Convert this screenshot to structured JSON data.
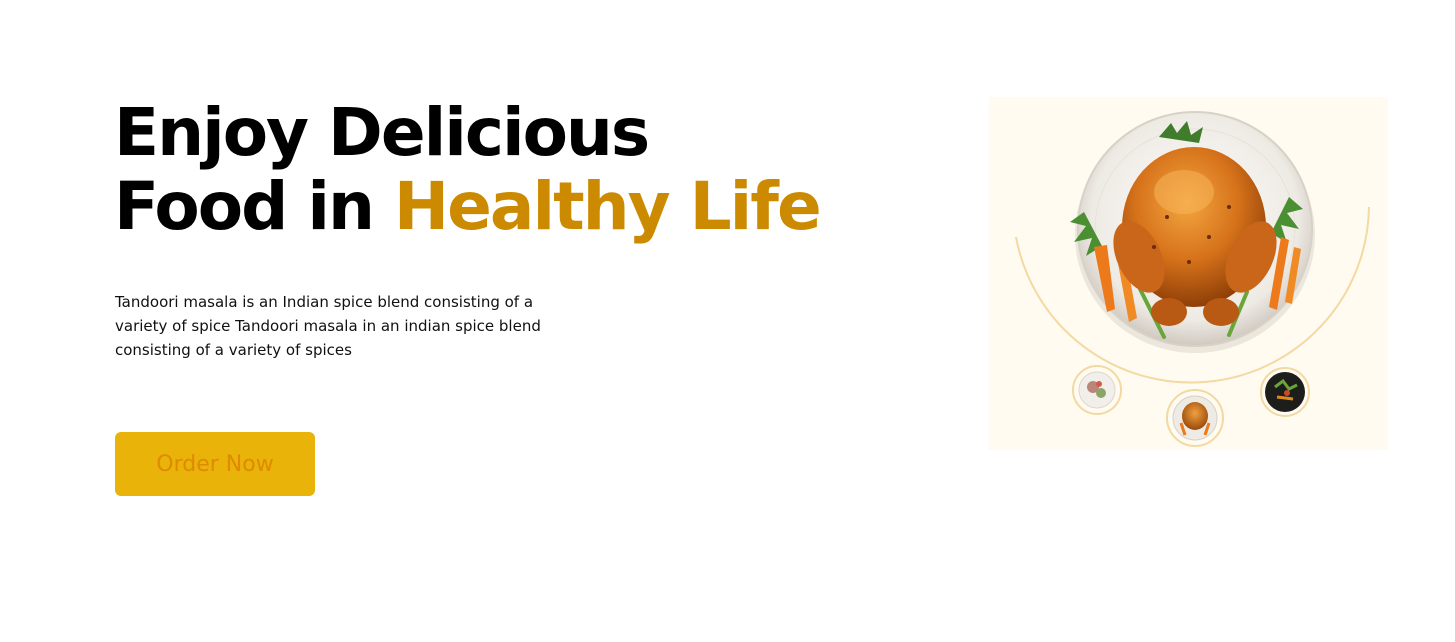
{
  "hero": {
    "headline_line1": "Enjoy Delicious",
    "headline_line2_prefix": "Food in ",
    "headline_line2_accent": "Healthy Life",
    "description": "Tandoori masala is an Indian spice blend consisting of a variety of spice Tandoori masala in an indian spice blend consisting of a variety of spices",
    "order_button_label": "Order Now"
  },
  "showcase": {
    "main_image": "roast-chicken-plate",
    "thumbnails": [
      "salad-plate-thumbnail",
      "roast-chicken-thumbnail",
      "dark-dish-thumbnail"
    ]
  },
  "colors": {
    "accent": "#cc8a00",
    "button_bg": "#e9b30a",
    "button_text": "#e08a00",
    "showcase_bg": "#fffbf1"
  }
}
